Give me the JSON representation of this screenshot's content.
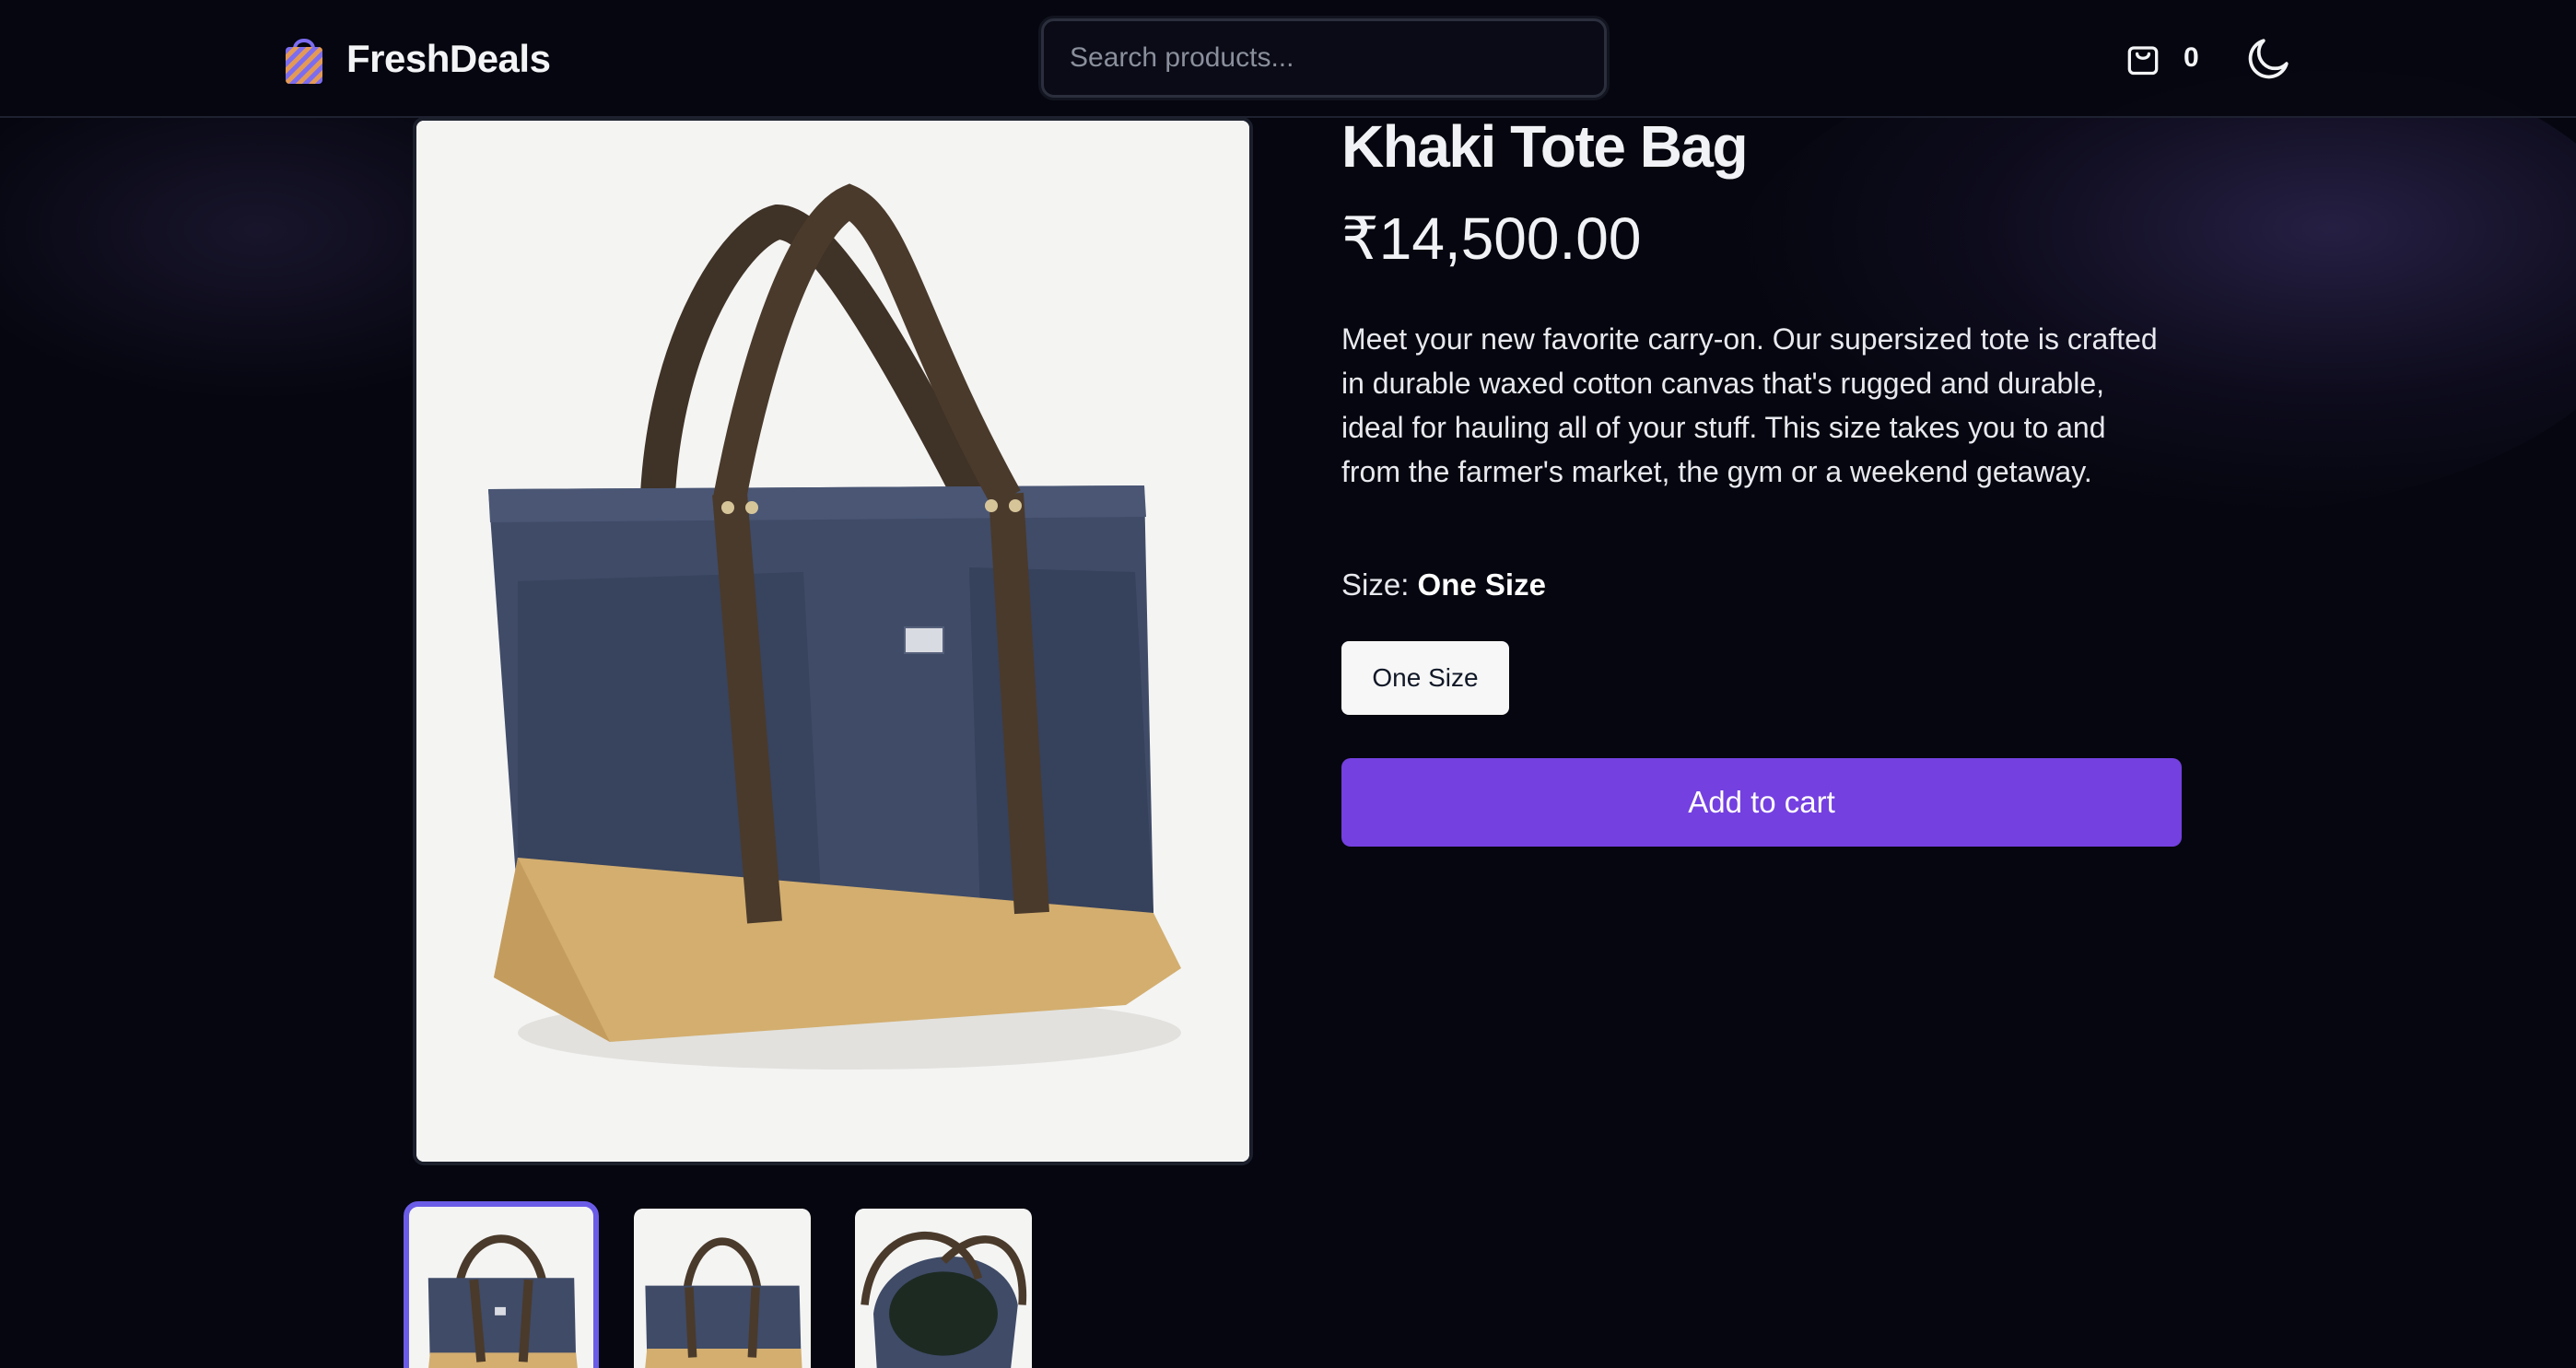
{
  "header": {
    "brand_name": "FreshDeals",
    "search_placeholder": "Search products...",
    "cart_count": "0"
  },
  "product": {
    "title": "Khaki Tote Bag",
    "price": "₹14,500.00",
    "description": "Meet your new favorite carry-on. Our supersized tote is crafted in durable waxed cotton canvas that's rugged and durable, ideal for hauling all of your stuff. This size takes you to and from the farmer's market, the gym or a weekend getaway.",
    "size_label": "Size:",
    "size_value": "One Size",
    "size_options": [
      "One Size"
    ],
    "add_to_cart_label": "Add to cart"
  },
  "gallery": {
    "selected_index": 0,
    "thumbnails": [
      "tote-front-view",
      "tote-side-view",
      "tote-interior-view"
    ]
  },
  "colors": {
    "accent": "#7440e0",
    "thumb_highlight": "#6b5ce7",
    "background": "#05060f",
    "bag_body": "#3d4a66",
    "bag_base": "#d2ad6e",
    "bag_strap": "#4a3b2c"
  },
  "icons": {
    "logo": "shopping-bag-icon",
    "cart": "cart-icon",
    "theme": "moon-icon"
  }
}
